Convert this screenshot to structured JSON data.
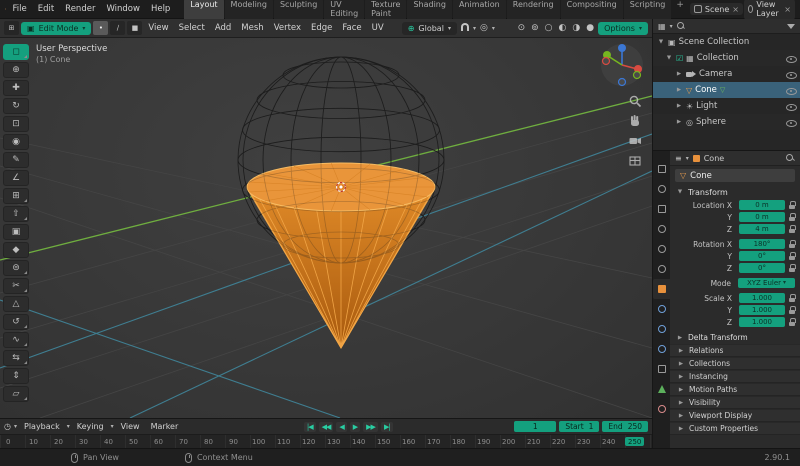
{
  "accent_color": "#14a07e",
  "icons": {
    "caret": "▾",
    "expander_open": "▼",
    "expander_closed": "▶",
    "close": "×",
    "add": "+",
    "checkbox": "☑",
    "mode_vertex": "•",
    "mode_edge": "∕",
    "mode_face": "■",
    "globe": "⊕",
    "proportional": "◎",
    "sun": "☀",
    "sphere": "◎",
    "cone": "▽",
    "mesh_data": "▽",
    "collection": "▦",
    "scene_collection": "▣",
    "editor_viewport": "⊞",
    "editor_props": "≡",
    "editor_time": "◷",
    "overlay_a": "⊙",
    "overlay_b": "⊚",
    "shade_wire": "○",
    "shade_solid": "◐",
    "shade_material": "◑",
    "shade_render": "●",
    "edit_mode_icon": "▣"
  },
  "topbar": {
    "menus": [
      "File",
      "Edit",
      "Render",
      "Window",
      "Help"
    ],
    "workspaces": [
      "Layout",
      "Modeling",
      "Sculpting",
      "UV Editing",
      "Texture Paint",
      "Shading",
      "Animation",
      "Rendering",
      "Compositing",
      "Scripting"
    ],
    "active_workspace": "Layout",
    "scene_label": "Scene",
    "view_layer_label": "View Layer"
  },
  "viewport_header": {
    "mode": "Edit Mode",
    "menus": [
      "View",
      "Select",
      "Add",
      "Mesh",
      "Vertex",
      "Edge",
      "Face",
      "UV"
    ],
    "orientation": "Global",
    "options_label": "Options"
  },
  "viewport": {
    "perspective_label": "User Perspective",
    "object_label": "(1) Cone"
  },
  "tools": [
    {
      "name": "select-box",
      "glyph": "◻"
    },
    {
      "name": "cursor",
      "glyph": "⊕"
    },
    {
      "name": "move",
      "glyph": "✚"
    },
    {
      "name": "rotate",
      "glyph": "↻"
    },
    {
      "name": "scale",
      "glyph": "⊡"
    },
    {
      "name": "transform",
      "glyph": "◉"
    },
    {
      "name": "annotate",
      "glyph": "✎"
    },
    {
      "name": "measure",
      "glyph": "∠"
    },
    {
      "name": "add-cube",
      "glyph": "⊞"
    },
    {
      "name": "extrude-region",
      "glyph": "⇧"
    },
    {
      "name": "inset-faces",
      "glyph": "▣"
    },
    {
      "name": "bevel",
      "glyph": "◆"
    },
    {
      "name": "loop-cut",
      "glyph": "⊜"
    },
    {
      "name": "knife",
      "glyph": "✂"
    },
    {
      "name": "poly-build",
      "glyph": "△"
    },
    {
      "name": "spin",
      "glyph": "↺"
    },
    {
      "name": "smooth",
      "glyph": "∿"
    },
    {
      "name": "edge-slide",
      "glyph": "⇆"
    },
    {
      "name": "shrink-fatten",
      "glyph": "⇕"
    },
    {
      "name": "shear",
      "glyph": "▱"
    }
  ],
  "outliner": {
    "scene_collection": "Scene Collection",
    "collection": "Collection",
    "objects": [
      "Camera",
      "Cone",
      "Light",
      "Sphere"
    ],
    "selected_object": "Cone"
  },
  "properties": {
    "breadcrumb_object": "Cone",
    "object_name": "Cone",
    "transform_label": "Transform",
    "rows": [
      {
        "label": "Location X",
        "value": "0 m"
      },
      {
        "label": "Y",
        "value": "0 m"
      },
      {
        "label": "Z",
        "value": "4 m"
      },
      {
        "label": "Rotation X",
        "value": "180°"
      },
      {
        "label": "Y",
        "value": "0°"
      },
      {
        "label": "Z",
        "value": "0°"
      },
      {
        "label": "Mode",
        "value": "XYZ Euler"
      },
      {
        "label": "Scale X",
        "value": "1.000"
      },
      {
        "label": "Y",
        "value": "1.000"
      },
      {
        "label": "Z",
        "value": "1.000"
      }
    ],
    "delta_transform_label": "Delta Transform",
    "sections": [
      "Relations",
      "Collections",
      "Instancing",
      "Motion Paths",
      "Visibility",
      "Viewport Display",
      "Custom Properties"
    ]
  },
  "timeline": {
    "menus": [
      "Playback",
      "Keying",
      "View",
      "Marker"
    ],
    "controls": [
      "|◀",
      "◀◀",
      "◀",
      "▶",
      "▶▶",
      "▶|"
    ],
    "current_frame": "1",
    "start_label": "Start",
    "start_value": "1",
    "end_label": "End",
    "end_value": "250",
    "frames": [
      "0",
      "10",
      "20",
      "30",
      "40",
      "50",
      "60",
      "70",
      "80",
      "90",
      "100",
      "110",
      "120",
      "130",
      "140",
      "150",
      "160",
      "170",
      "180",
      "190",
      "200",
      "210",
      "220",
      "230",
      "240"
    ],
    "end_frame_chip": "250"
  },
  "statusbar": {
    "pan_hint": "Pan View",
    "context_hint": "Context Menu",
    "version": "2.90.1"
  }
}
